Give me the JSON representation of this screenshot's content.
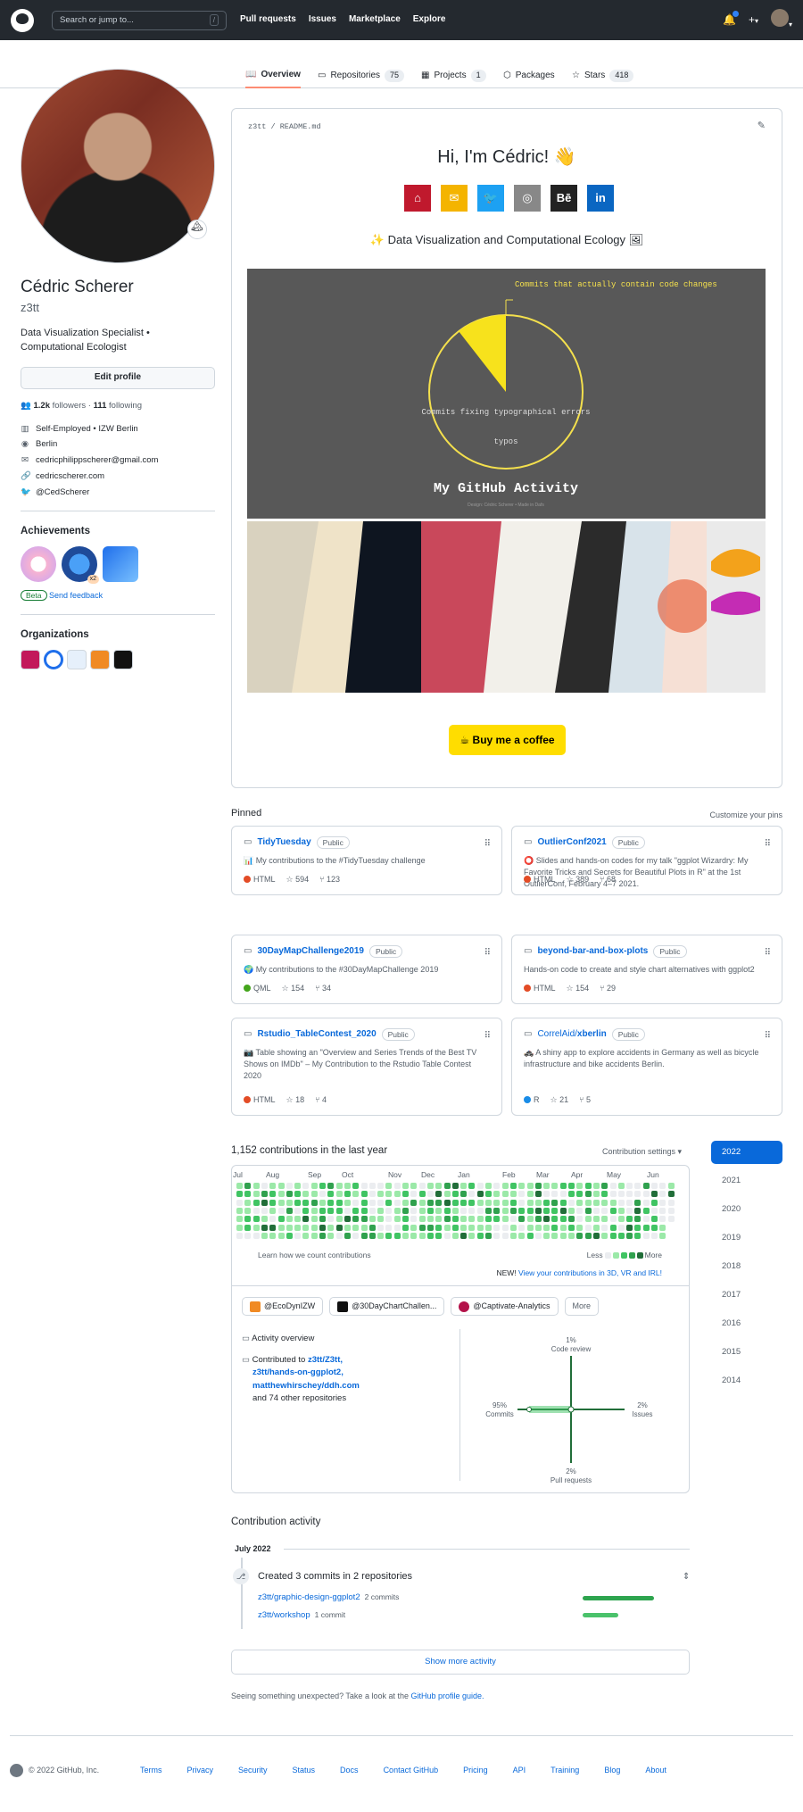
{
  "header": {
    "search_placeholder": "Search or jump to...",
    "slash": "/",
    "nav": [
      "Pull requests",
      "Issues",
      "Marketplace",
      "Explore"
    ],
    "plus": "+",
    "caret": "▾"
  },
  "tabs": {
    "overview": "Overview",
    "repositories": "Repositories",
    "repositories_count": "75",
    "projects": "Projects",
    "projects_count": "1",
    "packages": "Packages",
    "stars": "Stars",
    "stars_count": "418"
  },
  "profile": {
    "name": "Cédric Scherer",
    "login": "z3tt",
    "bio": "Data Visualization Specialist • Computational Ecologist",
    "edit_label": "Edit profile",
    "followers": "1.2k",
    "followers_label": "followers",
    "following": "111",
    "following_label": "following",
    "company": "Self-Employed • IZW Berlin",
    "location": "Berlin",
    "email": "cedricphilippscherer@gmail.com",
    "website": "cedricscherer.com",
    "twitter": "@CedScherer",
    "achievements_title": "Achievements",
    "achievement_count": "x2",
    "beta_label": "Beta",
    "feedback_label": "Send feedback",
    "organizations_title": "Organizations"
  },
  "readme": {
    "path": "z3tt / README.md",
    "greeting": "Hi, I'm Cédric! 👋",
    "tagline": "Data Visualization and Computational Ecology",
    "pie_label_top": "Commits that actually contain code changes",
    "pie_label_mid": "Commits fixing typographical errors",
    "pie_label_bottom": "typos",
    "pie_title": "My GitHub Activity",
    "pie_credit": "Design: Cédric Scherer • Made in Dafs",
    "coffee": "Buy me a coffee"
  },
  "pinned": {
    "title": "Pinned",
    "customize": "Customize your pins",
    "public_label": "Public",
    "items": [
      {
        "owner": "",
        "name": "TidyTuesday",
        "desc": "📊 My contributions to the #TidyTuesday challenge",
        "lang": "HTML",
        "stars": "594",
        "forks": "123"
      },
      {
        "owner": "",
        "name": "OutlierConf2021",
        "desc": "⭕ Slides and hands-on codes for my talk \"ggplot Wizardry: My Favorite Tricks and Secrets for Beautiful Plots in R\" at the 1st OutlierConf, February 4–7 2021.",
        "lang": "HTML",
        "stars": "389",
        "forks": "68"
      },
      {
        "owner": "",
        "name": "30DayMapChallenge2019",
        "desc": "🌍 My contributions to the #30DayMapChallenge 2019",
        "lang": "QML",
        "stars": "154",
        "forks": "34"
      },
      {
        "owner": "",
        "name": "beyond-bar-and-box-plots",
        "desc": "Hands-on code to create and style chart alternatives with ggplot2",
        "lang": "HTML",
        "stars": "154",
        "forks": "29"
      },
      {
        "owner": "",
        "name": "Rstudio_TableContest_2020",
        "desc": "📷 Table showing an \"Overview and Series Trends of the Best TV Shows on IMDb\" – My Contribution to the Rstudio Table Contest 2020",
        "lang": "HTML",
        "stars": "18",
        "forks": "4"
      },
      {
        "owner": "CorrelAid/",
        "name": "xberlin",
        "desc": "🚓 A shiny app to explore accidents in Germany as well as bicycle infrastructure and bike accidents Berlin.",
        "lang": "R",
        "stars": "21",
        "forks": "5"
      }
    ]
  },
  "contributions": {
    "title": "1,152 contributions in the last year",
    "settings": "Contribution settings ▾",
    "months": [
      "Jul",
      "Aug",
      "Sep",
      "Oct",
      "Nov",
      "Dec",
      "Jan",
      "Feb",
      "Mar",
      "Apr",
      "May",
      "Jun"
    ],
    "learn": "Learn how we count contributions",
    "less": "Less",
    "more": "More",
    "new_prefix": "NEW!",
    "new_link": "View your contributions in 3D, VR and IRL!",
    "years": [
      "2022",
      "2021",
      "2020",
      "2019",
      "2018",
      "2017",
      "2016",
      "2015",
      "2014"
    ],
    "orgs": [
      "@EcoDynIZW",
      "@30DayChartChallen...",
      "@Captivate-Analytics"
    ],
    "orgs_more": "More",
    "overview_title": "Activity overview",
    "contributed_to": "Contributed to",
    "repos": [
      "z3tt/Z3tt,",
      "z3tt/hands-on-ggplot2,",
      "matthewhirschey/ddh.com"
    ],
    "other_repos": "and 74 other repositories",
    "radar": {
      "code_review_pct": "1%",
      "code_review": "Code review",
      "commits_pct": "95%",
      "commits": "Commits",
      "issues_pct": "2%",
      "issues": "Issues",
      "pull_requests_pct": "2%",
      "pull_requests": "Pull requests"
    }
  },
  "activity": {
    "title": "Contribution activity",
    "month": "July 2022",
    "created": "Created 3 commits in 2 repositories",
    "repo1": "z3tt/graphic-design-ggplot2",
    "repo1_commits": "2 commits",
    "repo2": "z3tt/workshop",
    "repo2_commits": "1 commit",
    "show_more": "Show more activity",
    "unexpected": "Seeing something unexpected? Take a look at the",
    "guide": "GitHub profile guide."
  },
  "footer": {
    "copyright": "© 2022 GitHub, Inc.",
    "links": [
      "Terms",
      "Privacy",
      "Security",
      "Status",
      "Docs",
      "Contact GitHub",
      "Pricing",
      "API",
      "Training",
      "Blog",
      "About"
    ]
  }
}
